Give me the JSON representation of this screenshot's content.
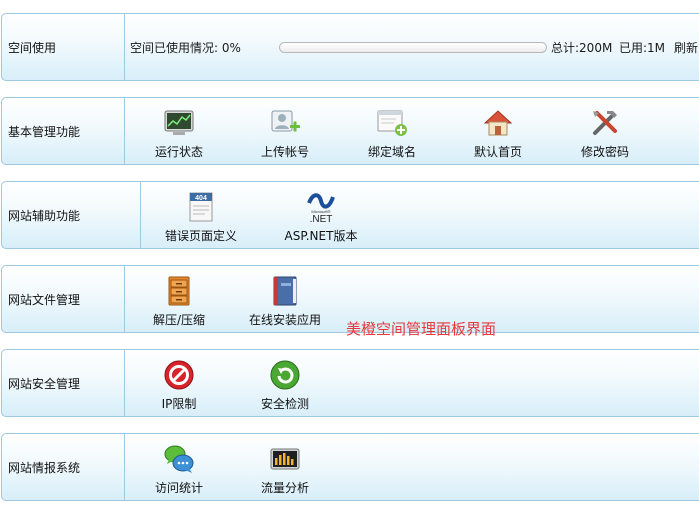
{
  "usage_section": {
    "title": "空间使用",
    "usage_text": "空间已使用情况: 0%",
    "progress_percent": 0,
    "total_text": "总计:200M",
    "used_text": "已用:1M",
    "refresh_label": "刷新"
  },
  "basic_section": {
    "title": "基本管理功能",
    "items": [
      {
        "label": "运行状态",
        "icon": "monitor-chart-icon"
      },
      {
        "label": "上传帐号",
        "icon": "add-user-icon"
      },
      {
        "label": "绑定域名",
        "icon": "add-window-icon"
      },
      {
        "label": "默认首页",
        "icon": "home-icon"
      },
      {
        "label": "修改密码",
        "icon": "tools-icon"
      }
    ]
  },
  "aux_section": {
    "title": "网站辅助功能",
    "items": [
      {
        "label": "错误页面定义",
        "icon": "404-page-icon",
        "badge": "404"
      },
      {
        "label": "ASP.NET版本",
        "icon": "dotnet-logo-icon",
        "logo_small": "Microsoft®",
        "logo_big": ".NET"
      }
    ]
  },
  "file_section": {
    "title": "网站文件管理",
    "items": [
      {
        "label": "解压/压缩",
        "icon": "cabinet-icon"
      },
      {
        "label": "在线安装应用",
        "icon": "book-icon"
      }
    ]
  },
  "security_section": {
    "title": "网站安全管理",
    "items": [
      {
        "label": "IP限制",
        "icon": "forbidden-icon"
      },
      {
        "label": "安全检测",
        "icon": "refresh-check-icon"
      }
    ]
  },
  "report_section": {
    "title": "网站情报系统",
    "items": [
      {
        "label": "访问统计",
        "icon": "chat-bubbles-icon"
      },
      {
        "label": "流量分析",
        "icon": "equalizer-icon"
      }
    ]
  },
  "caption": "美橙空间管理面板界面",
  "colors": {
    "border": "#9ec9de",
    "caption": "#e8383d",
    "progress": "#5fa7d8"
  }
}
